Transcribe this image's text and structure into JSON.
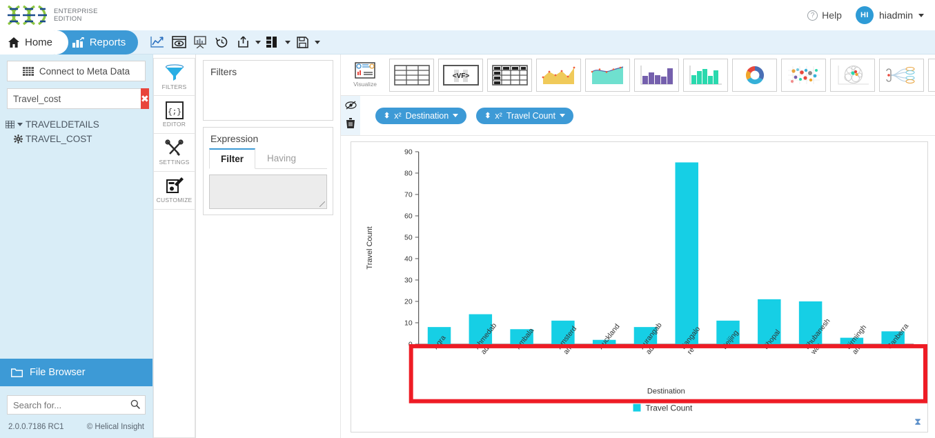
{
  "header": {
    "edition_line1": "ENTERPRISE",
    "edition_line2": "EDITION",
    "help_label": "Help",
    "help_icon": "question-circle-icon",
    "user_initials": "HI",
    "user_name": "hiadmin"
  },
  "nav": {
    "home_label": "Home",
    "separator": "›",
    "reports_label": "Reports",
    "icons": [
      {
        "name": "line-chart-icon"
      },
      {
        "name": "preview-eye-icon"
      },
      {
        "name": "presentation-chart-icon"
      },
      {
        "name": "history-clock-icon"
      },
      {
        "name": "export-share-icon",
        "dropdown": true
      },
      {
        "name": "layout-columns-icon",
        "dropdown": true
      },
      {
        "name": "save-disk-icon",
        "dropdown": true
      }
    ]
  },
  "sidebar": {
    "connect_label": "Connect to Meta Data",
    "connect_icon": "table-grid-icon",
    "search_value": "Travel_cost",
    "clear_label": "✖",
    "tree": [
      {
        "label": "TRAVELDETAILS",
        "icon": "table-icon",
        "expanded": true
      },
      {
        "label": "TRAVEL_COST",
        "icon": "gear-icon",
        "child": true
      }
    ],
    "file_browser_label": "File Browser",
    "file_browser_icon": "folder-icon",
    "search_placeholder": "Search for...",
    "search2_value": "",
    "version": "2.0.0.7186 RC1",
    "copyright": "© Helical Insight"
  },
  "rail": [
    {
      "label": "FILTERS",
      "icon": "funnel-icon"
    },
    {
      "label": "EDITOR",
      "icon": "code-braces-icon"
    },
    {
      "label": "SETTINGS",
      "icon": "tools-icon"
    },
    {
      "label": "CUSTOMIZE",
      "icon": "edit-form-icon"
    }
  ],
  "panels": {
    "filters_title": "Filters",
    "expression_title": "Expression",
    "tabs": [
      {
        "label": "Filter",
        "active": true
      },
      {
        "label": "Having",
        "active": false
      }
    ],
    "expression_value": ""
  },
  "chart_toolbar": [
    {
      "name": "visualize-icon",
      "label": "Visualize"
    },
    {
      "name": "table-icon",
      "label": ""
    },
    {
      "name": "vf-icon",
      "label": "<VF>"
    },
    {
      "name": "pivot-table-icon",
      "label": ""
    },
    {
      "name": "area-chart-icon",
      "label": ""
    },
    {
      "name": "spline-area-chart-icon",
      "label": ""
    },
    {
      "name": "column-chart-icon",
      "label": ""
    },
    {
      "name": "bar-histogram-icon",
      "label": ""
    },
    {
      "name": "donut-chart-icon",
      "label": ""
    },
    {
      "name": "bubble-chart-icon",
      "label": ""
    },
    {
      "name": "packed-circle-icon",
      "label": ""
    },
    {
      "name": "dendrogram-icon",
      "label": ""
    },
    {
      "name": "grouped-column-icon",
      "label": ""
    },
    {
      "name": "map-marker-icon",
      "label": ""
    },
    {
      "name": "globe-icon",
      "label": ""
    }
  ],
  "chips_tools": [
    {
      "name": "hide-eye-icon"
    },
    {
      "name": "trash-icon"
    }
  ],
  "chips": [
    {
      "label": "Destination",
      "prefix": "x²"
    },
    {
      "label": "Travel Count",
      "prefix": "x²"
    }
  ],
  "chart_footer": {
    "legend_label": "Travel Count",
    "legend_color": "#16CFE5",
    "hourglass_icon": "hourglass-icon"
  },
  "chart_data": {
    "type": "bar",
    "title": "",
    "xlabel": "Destination",
    "ylabel": "Travel Count",
    "ylim": [
      0,
      90
    ],
    "yticks": [
      0,
      10,
      20,
      30,
      40,
      50,
      60,
      70,
      80,
      90
    ],
    "grid": false,
    "legend": [
      "Travel Count"
    ],
    "legend_position": "bottom",
    "bar_color": "#16CFE5",
    "highlight_box_color": "#ee1c25",
    "categories": [
      "Agra",
      "Ahmedabad",
      "Ambala",
      "Amsterdam",
      "Auckland",
      "Aurangabad",
      "Bangalore",
      "Beijing",
      "Bhopal",
      "Bhubaneshwar",
      "Birmingham",
      "Canberra"
    ],
    "series": [
      {
        "name": "Travel Count",
        "values": [
          8,
          14,
          7,
          11,
          2,
          8,
          85,
          11,
          21,
          20,
          3,
          6
        ]
      }
    ]
  }
}
